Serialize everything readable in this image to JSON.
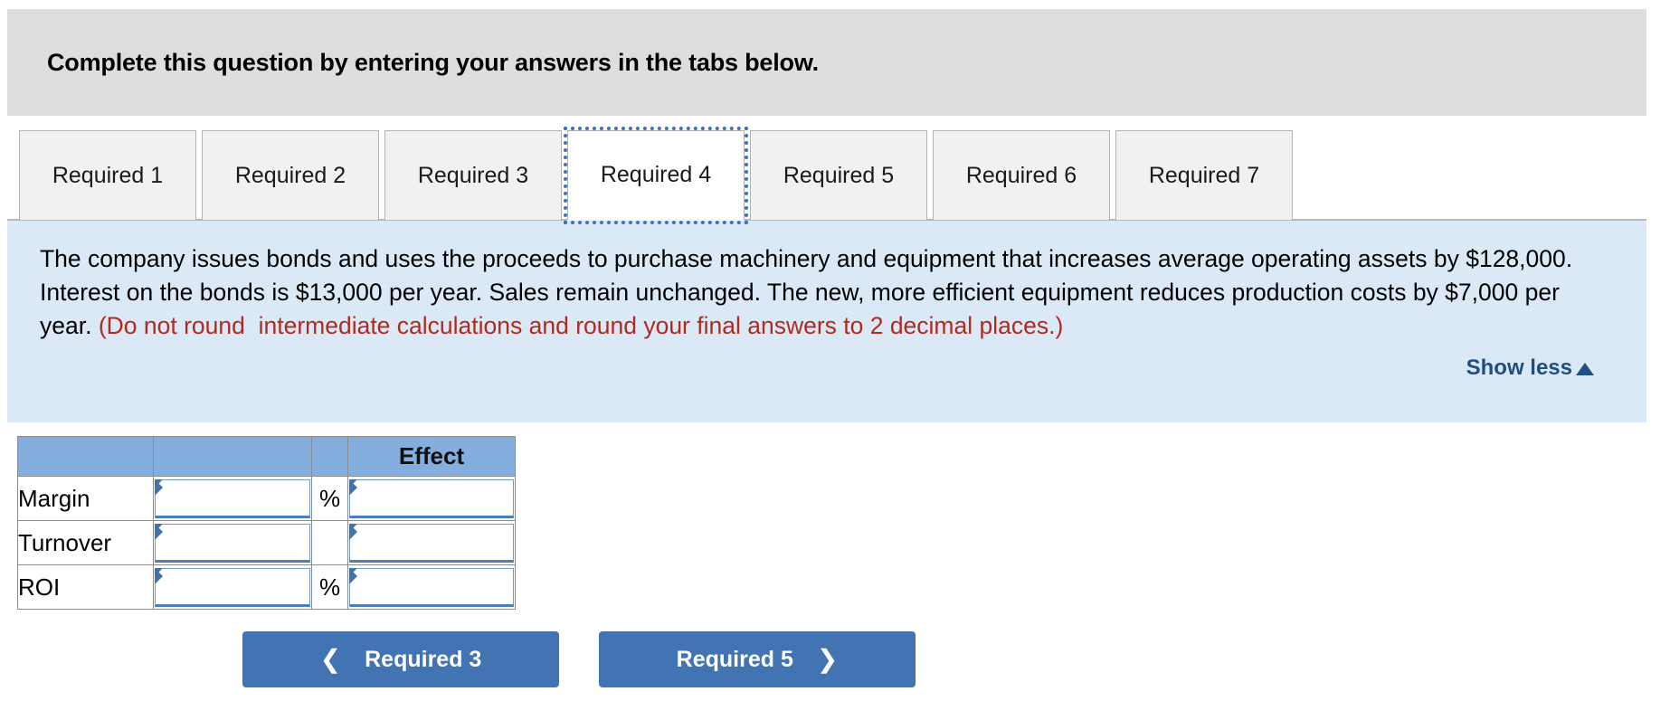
{
  "banner": {
    "text": "Complete this question by entering your answers in the tabs below."
  },
  "tabs": {
    "items": [
      {
        "label": "Required 1",
        "active": false
      },
      {
        "label": "Required 2",
        "active": false
      },
      {
        "label": "Required 3",
        "active": false
      },
      {
        "label": "Required 4",
        "active": true
      },
      {
        "label": "Required 5",
        "active": false
      },
      {
        "label": "Required 6",
        "active": false
      },
      {
        "label": "Required 7",
        "active": false
      }
    ]
  },
  "info": {
    "body_black_1": "The company issues bonds and uses the proceeds to purchase machinery and equipment that increases average operating assets by $128,000. Interest on the bonds is $13,000 per year. Sales remain unchanged. The new, more efficient equipment reduces production costs by $7,000 per year. ",
    "body_red": "(Do not round  intermediate calculations and round your final answers to 2 decimal places.)",
    "show_less_label": "Show less",
    "show_less_icon": "caret-up-icon"
  },
  "answer_table": {
    "headers": [
      "",
      "",
      "",
      "Effect"
    ],
    "rows": [
      {
        "label": "Margin",
        "value": "",
        "unit": "%",
        "effect": ""
      },
      {
        "label": "Turnover",
        "value": "",
        "unit": "",
        "effect": ""
      },
      {
        "label": "ROI",
        "value": "",
        "unit": "%",
        "effect": ""
      }
    ]
  },
  "nav": {
    "prev_label": "Required 3",
    "prev_icon": "chevron-left-icon",
    "next_label": "Required 5",
    "next_icon": "chevron-right-icon"
  },
  "colors": {
    "banner_bg": "#dedede",
    "info_bg": "#dbe9f7",
    "table_header_bg": "#84aedd",
    "accent_blue": "#4274b3",
    "link_blue": "#1f4e83",
    "warning_red": "#b02a1e"
  }
}
